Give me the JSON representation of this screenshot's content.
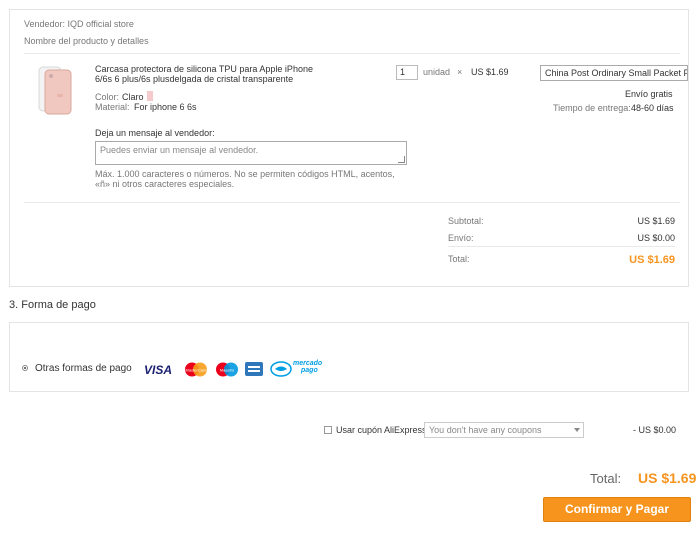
{
  "order": {
    "seller": "Vendedor: IQD official store",
    "product_header": "Nombre del producto y detalles",
    "product": {
      "title_line1": "Carcasa protectora de silicona TPU para Apple iPhone",
      "title_line2": "6/6s 6 plus/6s plusdelgada de cristal transparente",
      "color_label": "Color:",
      "color_value": "Claro",
      "material_label": "Material:",
      "material_value": "For iphone 6 6s"
    },
    "quantity": "1",
    "unit": "unidad",
    "times": "×",
    "unit_price": "US $1.69",
    "shipping_method": "China Post Ordinary Small Packet Plus",
    "shipping_cost": "Envío gratis",
    "delivery_label": "Tiempo de entrega:",
    "delivery_value": "48-60 días",
    "message_label": "Deja un mensaje al vendedor:",
    "message_placeholder": "Puedes enviar un mensaje al vendedor.",
    "message_hint_line1": "Máx. 1.000 caracteres o números. No se permiten códigos HTML, acentos,",
    "message_hint_line2": "«ñ» ni otros caracteres especiales.",
    "subtotal_label": "Subtotal:",
    "subtotal_value": "US $1.69",
    "shipping_label": "Envío:",
    "shipping_value": "US $0.00",
    "total_label": "Total:",
    "total_value": "US $1.69"
  },
  "payment": {
    "section_title": "3. Forma de pago",
    "option_label": "Otras formas de pago",
    "logos": {
      "visa": "VISA",
      "mastercard": "MasterCard",
      "maestro": "Maestro",
      "mercadopago_line1": "mercado",
      "mercadopago_line2": "pago"
    }
  },
  "coupon": {
    "label": "Usar cupón AliExpress",
    "select_value": "You don't have any coupons",
    "discount": "- US $0.00"
  },
  "summary": {
    "total_label": "Total:",
    "total_value": "US $1.69",
    "confirm_label": "Confirmar y Pagar"
  },
  "colors": {
    "accent": "#f7941e",
    "visa_blue": "#1a1f71",
    "mastercard_red": "#eb001b",
    "mastercard_yellow": "#f79e1b",
    "maestro_blue": "#0099df",
    "amex_blue": "#2e77bb",
    "mercadopago_blue": "#009ee3"
  },
  "icons": [
    "product-thumbnail",
    "radio-icon",
    "checkbox-icon",
    "dropdown-arrow-icon",
    "resize-grip-icon"
  ]
}
